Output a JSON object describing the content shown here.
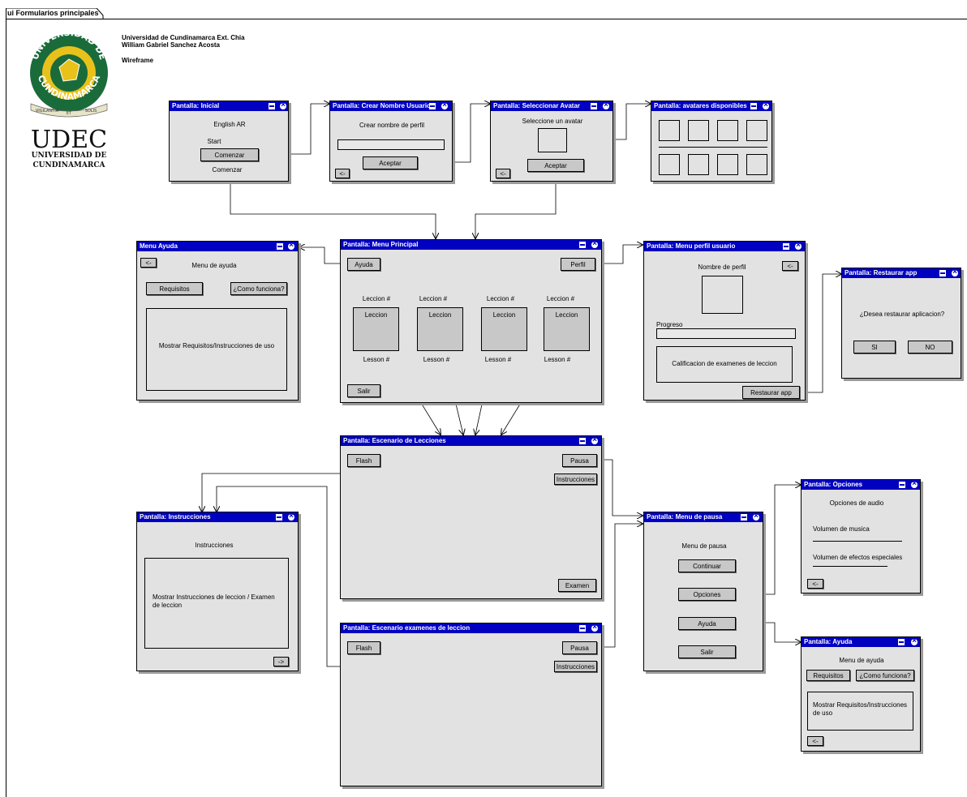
{
  "frame_title": "ui Formularios principales",
  "header": {
    "line1": "Universidad de Cundinamarca Ext. Chia",
    "line2": "William Gabriel Sanchez Acosta",
    "line3": "Wireframe"
  },
  "logo": {
    "seal_top": "UNIVERSIDAD DE",
    "seal_bottom": "CUNDINAMARCA",
    "ribbon_left": "VIGILANTIA",
    "ribbon_mid": "ET",
    "ribbon_right": "SOLIS",
    "mark": "UDEC",
    "name1": "UNIVERSIDAD DE",
    "name2": "CUNDINAMARCA",
    "colors": {
      "green": "#1a6b3a",
      "gold": "#e8c21a",
      "dark": "#111111"
    }
  },
  "colors": {
    "titlebar": "#0000c0",
    "window": "#e2e2e2",
    "button": "#c8c8c8",
    "shadow": "#9a9a9a"
  },
  "win_inicial": {
    "title": "Pantalla: Inicial",
    "app": "English AR",
    "start": "Start",
    "button": "Comenzar",
    "caption": "Comenzar"
  },
  "win_crear": {
    "title": "Pantalla: Crear Nombre Usuario",
    "label": "Crear nombre de perfil",
    "accept": "Aceptar",
    "back": "<-"
  },
  "win_avatar": {
    "title": "Pantalla: Seleccionar Avatar",
    "label": "Seleccione un avatar",
    "accept": "Aceptar",
    "back": "<-"
  },
  "win_avatares": {
    "title": "Pantalla: avatares disponibles"
  },
  "win_ayuda1": {
    "title": "Menu Ayuda",
    "back": "<-",
    "heading": "Menu de ayuda",
    "req": "Requisitos",
    "how": "¿Como funciona?",
    "content": "Mostrar Requisitos/Instrucciones de uso"
  },
  "win_menu": {
    "title": "Pantalla: Menu Principal",
    "help": "Ayuda",
    "profile": "Perfil",
    "exit": "Salir",
    "lessons": [
      {
        "top": "Leccion #",
        "box": "Leccion",
        "bottom": "Lesson #"
      },
      {
        "top": "Leccion #",
        "box": "Leccion",
        "bottom": "Lesson #"
      },
      {
        "top": "Leccion #",
        "box": "Leccion",
        "bottom": "Lesson #"
      },
      {
        "top": "Leccion #",
        "box": "Leccion",
        "bottom": "Lesson #"
      }
    ]
  },
  "win_perfil": {
    "title": "Pantalla: Menu perfil usuario",
    "name": "Nombre de perfil",
    "back": "<-",
    "progress": "Progreso",
    "grades": "Calificacion de examenes de leccion",
    "restore": "Restaurar app"
  },
  "win_restaurar": {
    "title": "Pantalla: Restaurar app",
    "question": "¿Desea restaurar aplicacion?",
    "yes": "SI",
    "no": "NO"
  },
  "win_escenario": {
    "title": "Pantalla: Escenario de Lecciones",
    "flash": "Flash",
    "pause": "Pausa",
    "instructions": "Instrucciones",
    "exam": "Examen"
  },
  "win_instrucciones": {
    "title": "Pantalla: Instrucciones",
    "heading": "Instrucciones",
    "content": "Mostrar Instrucciones de leccion / Examen de leccion",
    "next": "->"
  },
  "win_examenes": {
    "title": "Pantalla: Escenario examenes de leccion",
    "flash": "Flash",
    "pause": "Pausa",
    "instructions": "Instrucciones"
  },
  "win_pausa": {
    "title": "Pantalla: Menu de pausa",
    "heading": "Menu de pausa",
    "continue": "Continuar",
    "options": "Opciones",
    "help": "Ayuda",
    "exit": "Salir"
  },
  "win_opciones": {
    "title": "Pantalla: Opciones",
    "heading": "Opciones de audio",
    "music": "Volumen de musica",
    "effects": "Volumen de efectos especiales",
    "back": "<-"
  },
  "win_ayuda2": {
    "title": "Pantalla: Ayuda",
    "heading": "Menu de ayuda",
    "req": "Requisitos",
    "how": "¿Como funciona?",
    "content": "Mostrar Requisitos/Instrucciones de uso",
    "back": "<-"
  }
}
